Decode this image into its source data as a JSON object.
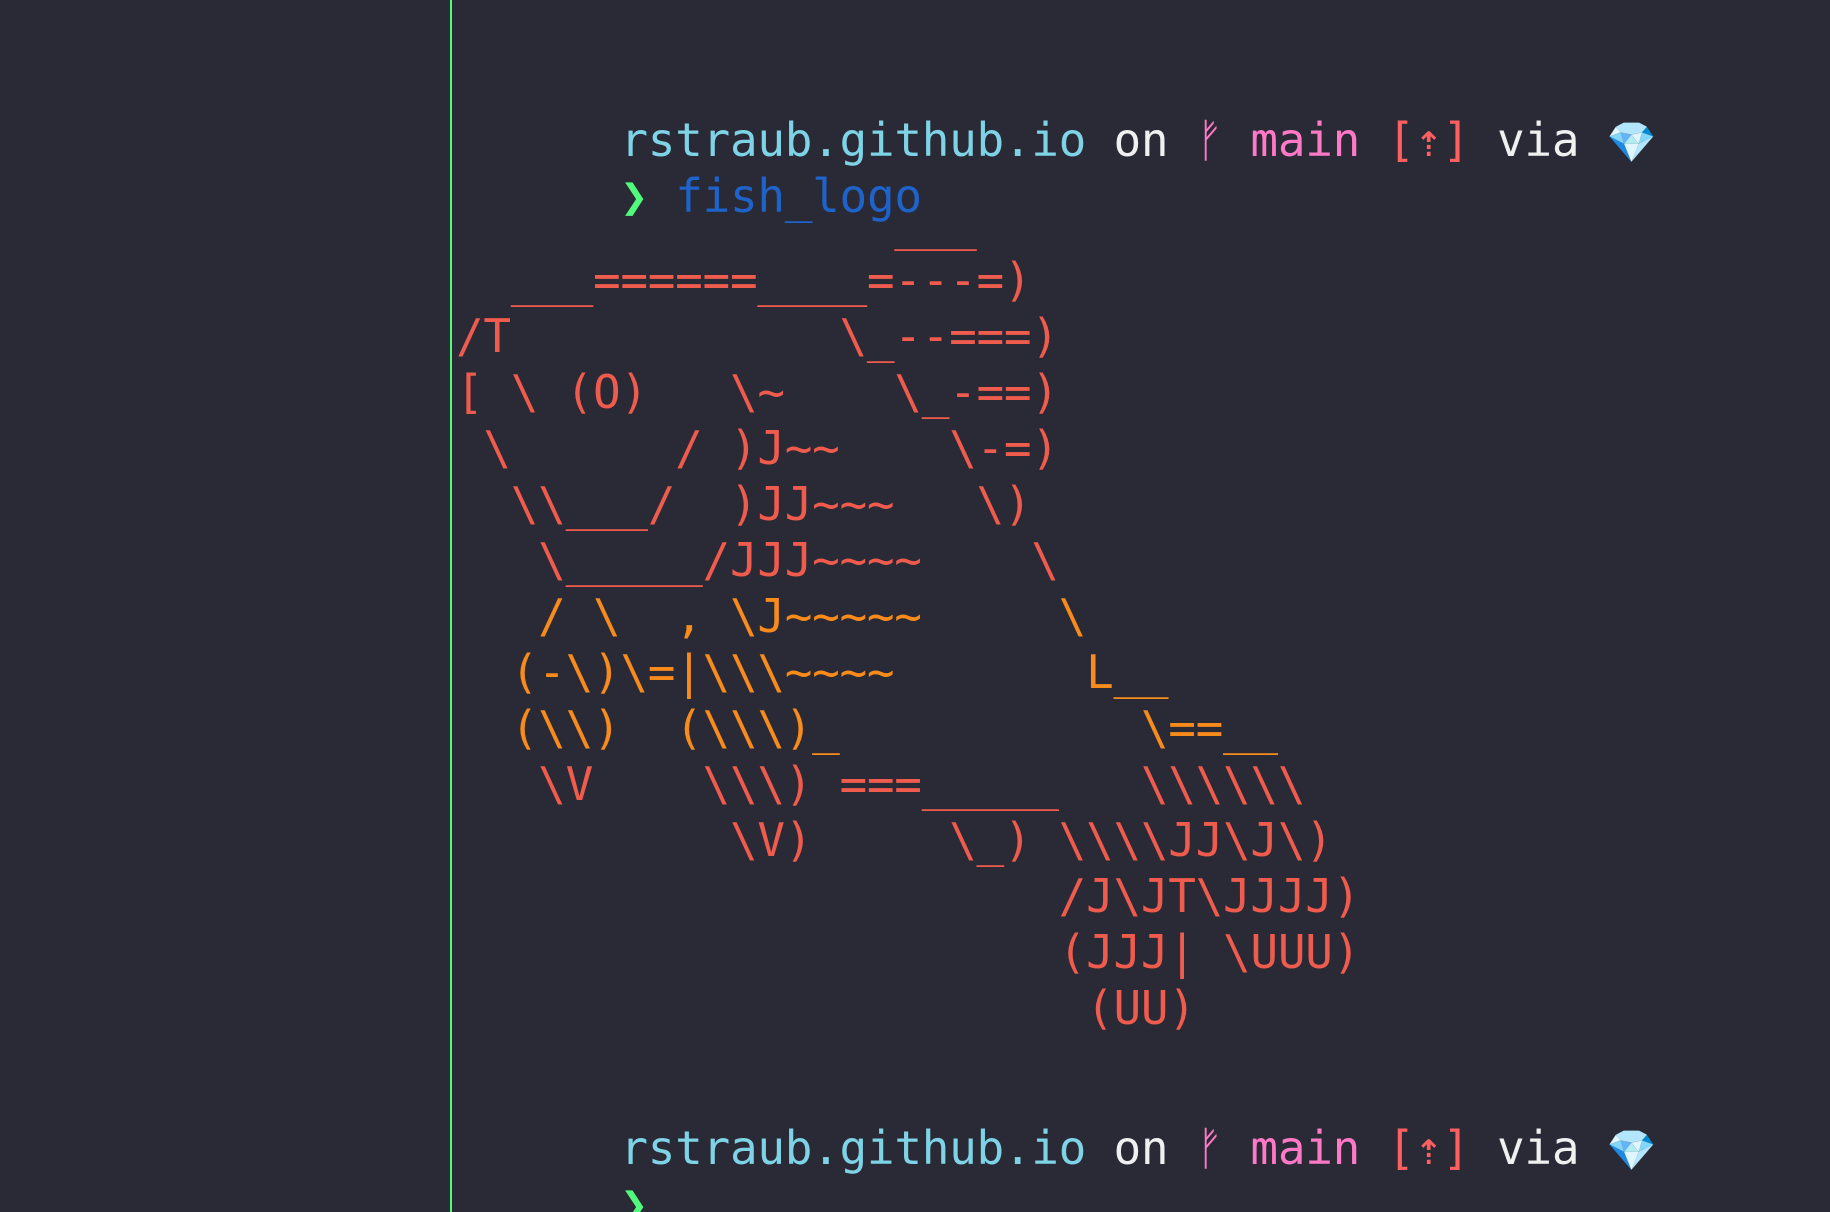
{
  "prompt1": {
    "directory": "rstraub.github.io",
    "on_text": "on",
    "branch_icon": "ᚠ",
    "branch": "main",
    "status_open": "[",
    "status_icon": "⇡",
    "status_close": "]",
    "via_text": "via",
    "ruby_icon": "💎"
  },
  "command_line": {
    "prompt_symbol": "❯",
    "command": "fish_logo"
  },
  "fish_logo_art": [
    "                ___",
    "  ___======____=---=)",
    "/T            \\_--===)",
    "[ \\ (O)   \\~    \\_-==)",
    " \\      / )J~~    \\-=)",
    "  \\\\___/  )JJ~~~   \\)",
    "   \\_____/JJJ~~~~    \\",
    "   / \\  , \\J~~~~~     \\",
    "  (-\\)\\=|\\\\\\~~~~       L__",
    "  (\\\\)  (\\\\\\)_           \\==__",
    "   \\V    \\\\\\) ===_____   \\\\\\\\\\\\",
    "          \\V)     \\_) \\\\\\\\JJ\\J\\)",
    "                      /J\\JT\\JJJJ)",
    "                      (JJJ| \\UUU)",
    "                       (UU)"
  ],
  "prompt2": {
    "directory": "rstraub.github.io",
    "on_text": "on",
    "branch_icon": "ᚠ",
    "branch": "main",
    "status_open": "[",
    "status_icon": "⇡",
    "status_close": "]",
    "via_text": "via",
    "ruby_icon": "💎"
  },
  "input_line": {
    "prompt_symbol": "❯",
    "command": ""
  },
  "colors": {
    "background": "#292a36",
    "directory": "#7fd3e6",
    "branch": "#ff79c6",
    "status": "#ff5f5f",
    "prompt_symbol": "#50fa7b",
    "command": "#1e63c9",
    "logo_red": "#ef5b4c",
    "logo_orange": "#f88b1c",
    "logo_yellow": "#f1fa8c"
  }
}
